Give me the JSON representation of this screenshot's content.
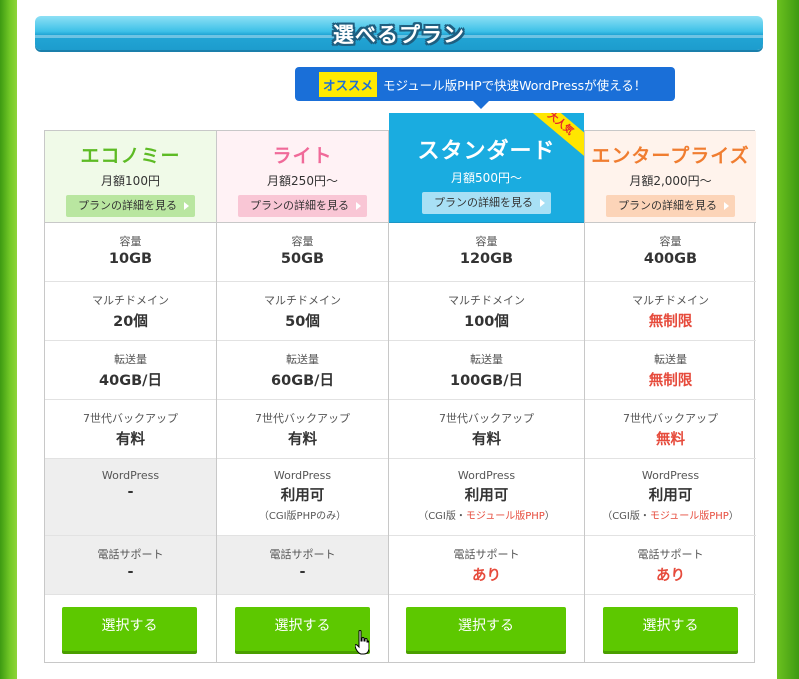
{
  "title": "選べるプラン",
  "promo": {
    "tag": "オススメ",
    "text": "モジュール版PHPで快速WordPressが使える！"
  },
  "ribbon": "大人気",
  "detail_label": "プランの詳細を見る",
  "select_label": "選択する",
  "labels": {
    "capacity": "容量",
    "multi_domain": "マルチドメイン",
    "transfer": "転送量",
    "backup": "7世代バックアップ",
    "wordpress": "WordPress",
    "phone": "電話サポート"
  },
  "plans": [
    {
      "name": "エコノミー",
      "price": "月額100円",
      "capacity": "10GB",
      "multi_domain": "20個",
      "transfer": "40GB/日",
      "backup": "有料",
      "wordpress": "-",
      "wordpress_note": "",
      "phone": "-"
    },
    {
      "name": "ライト",
      "price": "月額250円～",
      "capacity": "50GB",
      "multi_domain": "50個",
      "transfer": "60GB/日",
      "backup": "有料",
      "wordpress": "利用可",
      "wordpress_note": "（CGI版PHPのみ）",
      "phone": "-"
    },
    {
      "name": "スタンダード",
      "price": "月額500円～",
      "capacity": "120GB",
      "multi_domain": "100個",
      "transfer": "100GB/日",
      "backup": "有料",
      "wordpress": "利用可",
      "wordpress_note_a": "（CGI版・",
      "wordpress_note_b": "モジュール版PHP",
      "wordpress_note_c": "）",
      "phone": "あり"
    },
    {
      "name": "エンタープライズ",
      "price": "月額2,000円～",
      "capacity": "400GB",
      "multi_domain": "無制限",
      "transfer": "無制限",
      "backup": "無料",
      "wordpress": "利用可",
      "wordpress_note_a": "（CGI版・",
      "wordpress_note_b": "モジュール版PHP",
      "wordpress_note_c": "）",
      "phone": "あり"
    }
  ],
  "colors": {
    "green_button": "#5dc800",
    "red_value": "#e64b3c",
    "standard_blue": "#1aace0"
  }
}
